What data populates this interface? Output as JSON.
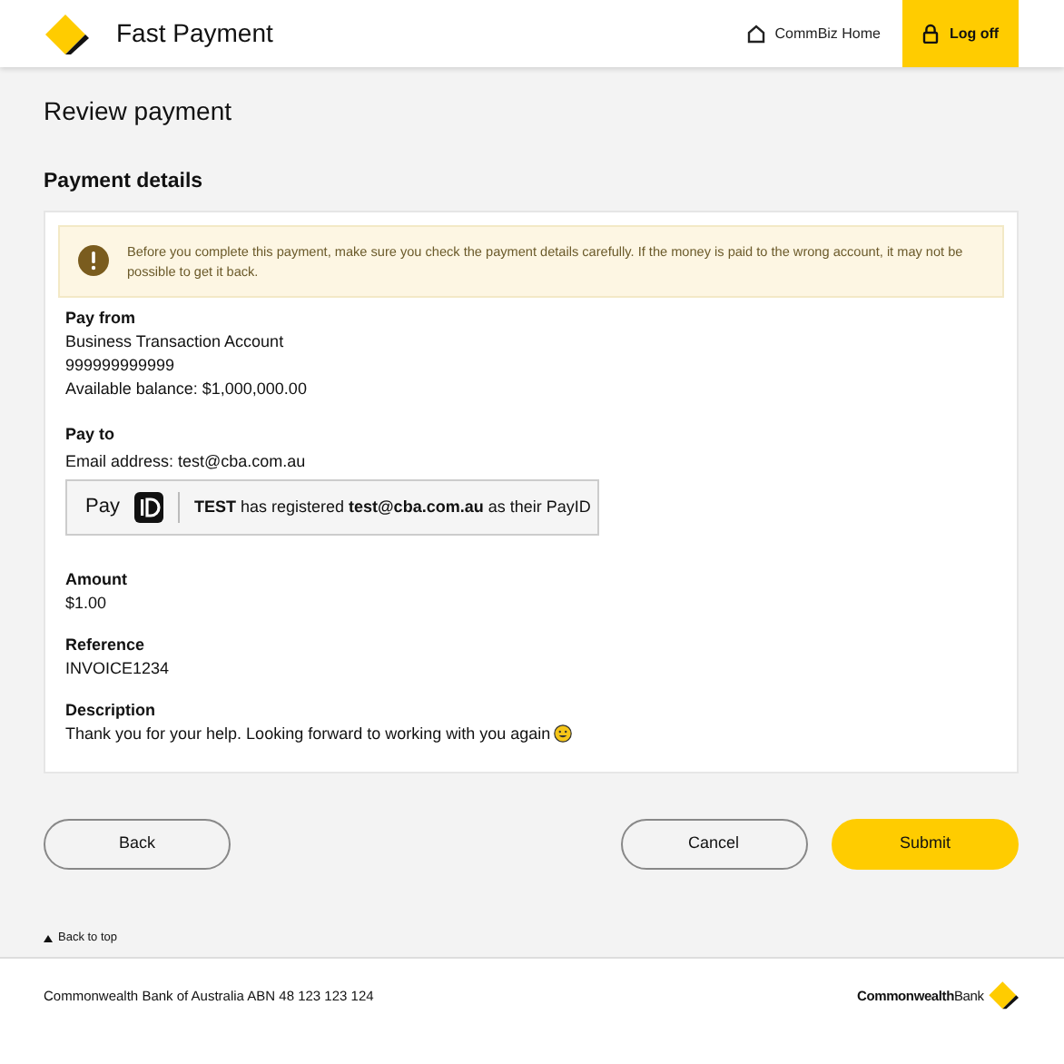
{
  "header": {
    "title": "Fast Payment",
    "nav": [
      {
        "kind": "home",
        "label": "CommBiz Home"
      },
      {
        "kind": "logoff",
        "label": "Log off"
      }
    ]
  },
  "page_title": "Review payment",
  "section_title": "Payment details",
  "alert": "Before you complete this payment, make sure you check the payment details carefully. If the money is paid to the wrong account, it may not be possible to get it back.",
  "pay_from": {
    "label": "Pay from",
    "lines": [
      "Business Transaction Account",
      "999999999999",
      "Available balance: $1,000,000.00"
    ]
  },
  "pay_to": {
    "label": "Pay to",
    "email": "Email address: test@cba.com.au",
    "payid_brand": "Pay",
    "payid_text": "**TEST** has registered **test@cba.com.au** as their PayID"
  },
  "details": [
    {
      "label": "Amount",
      "value": "$1.00"
    },
    {
      "label": "Reference",
      "value": "INVOICE1234"
    },
    {
      "label": "Description",
      "value": "Thank you for your help. Looking forward to working with you again",
      "emoji": true
    }
  ],
  "buttons": [
    {
      "kind": "secondary",
      "label": "Back"
    },
    {
      "kind": "secondary",
      "label": "Cancel"
    },
    {
      "kind": "primary",
      "label": "Submit"
    }
  ],
  "back_to_top": "Back to top",
  "footer": {
    "text": "Commonwealth Bank of Australia ABN 48 123 123 124",
    "logo_text": "**Commonwealth**Bank"
  }
}
